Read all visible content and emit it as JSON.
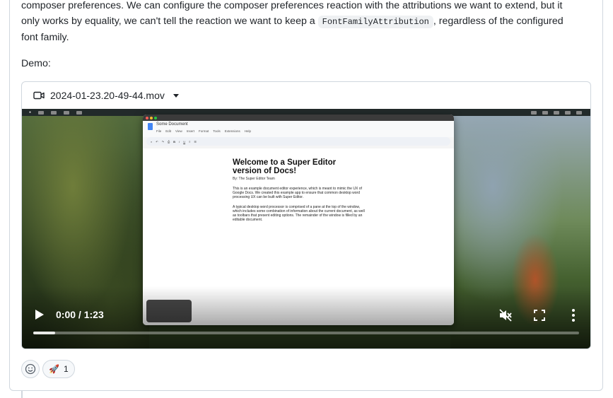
{
  "comment": {
    "text_line1": "composer preferences. We can configure the composer preferences reaction with the attributions we want to extend, but it",
    "text_line2_before_code": "only works by equality, we can't tell the reaction we want to keep a ",
    "code_inline": "FontFamilyAttribution",
    "text_line2_after_code": ", regardless of the configured",
    "text_line3": "font family.",
    "demo_label": "Demo:"
  },
  "video": {
    "filename": "2024-01-23.20-49-44.mov",
    "current_time": "0:00",
    "duration": "1:23",
    "time_separator": " / ",
    "progress_fraction": 0.04,
    "muted": true,
    "frame": {
      "app_window_title": "Some Document",
      "doc_title": "Welcome to a Super Editor version of Docs!",
      "doc_byline": "By: The Super Editor Team",
      "doc_paragraph_1": "This is an example document editor experience, which is meant to mimic the UX of Google Docs. We created this example app to ensure that common desktop word processing UX can be built with Super Editor.",
      "doc_paragraph_2": "A typical desktop word processor is comprised of a pane at the top of the window, which includes some combination of information about the current document, as well as toolbars that present editing options. The remainder of the window is filled by an editable document.",
      "menu_items": [
        "File",
        "Edit",
        "View",
        "Insert",
        "Format",
        "Tools",
        "Extensions",
        "Help"
      ]
    }
  },
  "reactions": {
    "items": [
      {
        "emoji": "🚀",
        "count": "1"
      }
    ]
  },
  "colors": {
    "border": "#d0d7de",
    "text": "#1f2328",
    "code_bg": "#eff1f3",
    "docs_blue": "#4285f4"
  }
}
